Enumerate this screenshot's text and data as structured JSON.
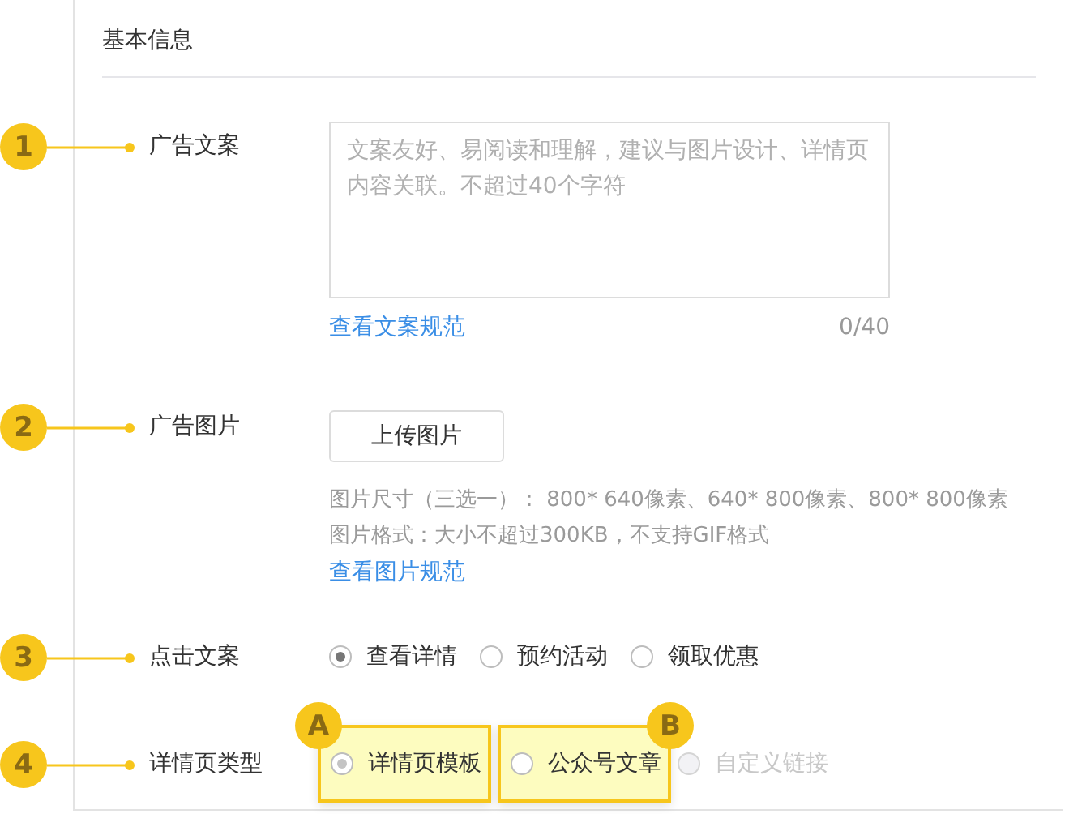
{
  "section_title": "基本信息",
  "fields": [
    {
      "kind": "textarea",
      "marker": "1",
      "label": "广告文案",
      "placeholder": "文案友好、易阅读和理解，建议与图片设计、详情页内容关联。不超过40个字符",
      "link": "查看文案规范",
      "counter": "0/40"
    },
    {
      "kind": "upload",
      "marker": "2",
      "label": "广告图片",
      "button": "上传图片",
      "hints": [
        "图片尺寸（三选一）： 800* 640像素、640* 800像素、800* 800像素",
        "图片格式：大小不超过300KB，不支持GIF格式"
      ],
      "link": "查看图片规范"
    },
    {
      "kind": "radio",
      "marker": "3",
      "label": "点击文案",
      "options": [
        {
          "label": "查看详情",
          "selected": true,
          "disabled": false
        },
        {
          "label": "预约活动",
          "selected": false,
          "disabled": false
        },
        {
          "label": "领取优惠",
          "selected": false,
          "disabled": false
        }
      ]
    },
    {
      "kind": "radio",
      "marker": "4",
      "label": "详情页类型",
      "options": [
        {
          "label": "详情页模板",
          "selected": true,
          "disabled": false,
          "callout": "A"
        },
        {
          "label": "公众号文章",
          "selected": false,
          "disabled": false,
          "callout": "B"
        },
        {
          "label": "自定义链接",
          "selected": false,
          "disabled": true
        }
      ]
    }
  ]
}
